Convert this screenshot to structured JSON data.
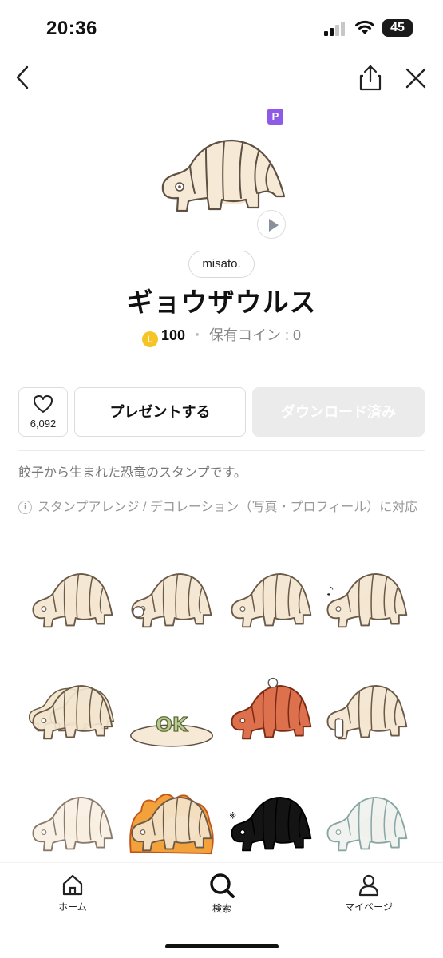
{
  "status_bar": {
    "time": "20:36",
    "battery": "45"
  },
  "product": {
    "premium_badge": "P",
    "author": "misato.",
    "title": "ギョウザウルス",
    "coin_symbol": "L",
    "price": "100",
    "separator": "・",
    "owned_coins": "保有コイン : 0"
  },
  "actions": {
    "like_count": "6,092",
    "present_label": "プレゼントする",
    "download_label": "ダウンロード済み"
  },
  "description": "餃子から生まれた恐竜のスタンプです。",
  "feature_note": "スタンプアレンジ / デコレーション（写真・プロフィール）に対応",
  "sticker_variants": [
    "plain",
    "ok-sign",
    "standing",
    "music-note",
    "group",
    "ok-plate",
    "red-angry",
    "hungry",
    "sketch",
    "fire",
    "black",
    "wrapped"
  ],
  "stickers": {
    "ok_text": "OK"
  },
  "tab_bar": {
    "home": "ホーム",
    "search": "検索",
    "mypage": "マイページ"
  },
  "colors": {
    "premium": "#8d5be8",
    "coin": "#f5c525",
    "dumpling_fill": "#f3e6cf",
    "dumpling_stroke": "#6b5a48",
    "download_disabled": "#ebebeb"
  }
}
